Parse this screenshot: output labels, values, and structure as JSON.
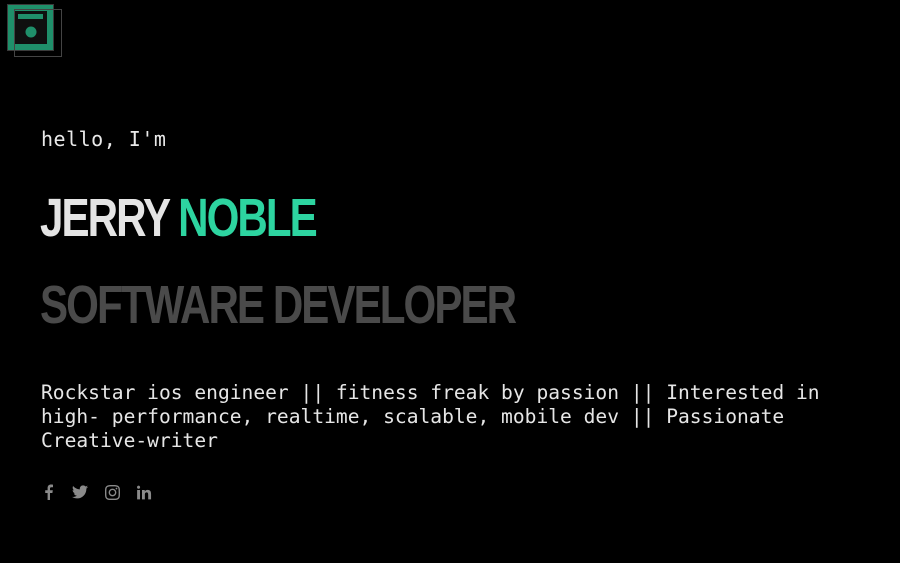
{
  "logo": {
    "icon": "floppy-disk-icon",
    "color": "#1f8f6a"
  },
  "hero": {
    "greeting": "hello, I'm",
    "first_name": "JERRY",
    "last_name": "NOBLE",
    "role": "SOFTWARE DEVELOPER",
    "bio": "Rockstar ios engineer || fitness freak by passion || Interested in\nhigh- performance, realtime, scalable, mobile dev || Passionate\nCreative-writer"
  },
  "social": [
    {
      "name": "facebook-icon"
    },
    {
      "name": "twitter-icon"
    },
    {
      "name": "instagram-icon"
    },
    {
      "name": "linkedin-icon"
    }
  ],
  "colors": {
    "background": "#000000",
    "accent": "#2dd4a0",
    "name_primary": "#e4e4e4",
    "role": "#4a4a4a",
    "icon": "#8a8a8a"
  }
}
